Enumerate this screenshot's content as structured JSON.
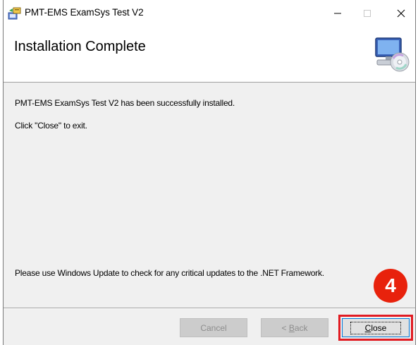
{
  "window": {
    "title": "PMT-EMS ExamSys Test V2",
    "app_icon": "installer-icon",
    "controls": {
      "minimize": "minimize-icon",
      "maximize": "maximize-icon",
      "close": "close-icon"
    }
  },
  "header": {
    "title": "Installation Complete",
    "graphic": "computer-cd-icon"
  },
  "content": {
    "message_success": "PMT-EMS ExamSys Test V2 has been successfully installed.",
    "message_exit": "Click \"Close\" to exit.",
    "message_update": "Please use Windows Update to check for any critical updates to the .NET Framework."
  },
  "buttons": {
    "cancel": {
      "label": "Cancel",
      "enabled": false
    },
    "back": {
      "label_accel": "B",
      "label_rest": "ack",
      "prefix": "< ",
      "enabled": false
    },
    "close": {
      "label_accel": "C",
      "label_rest": "lose",
      "enabled": true
    }
  },
  "annotation": {
    "step_number": "4",
    "color": "#e8220c",
    "highlight_color": "#e11b22"
  }
}
